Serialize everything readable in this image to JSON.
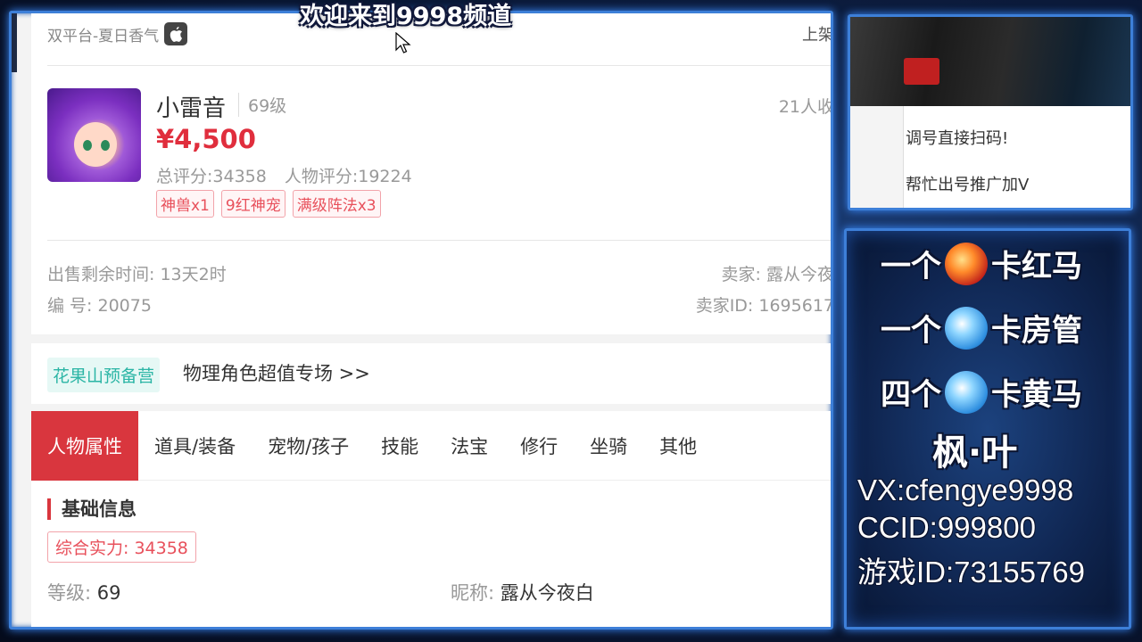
{
  "overlay": {
    "title": "欢迎来到9998频道"
  },
  "listing": {
    "platform": "双平台-夏日香气",
    "listed_label": "上架",
    "character_name": "小雷音",
    "level_badge": "69级",
    "favorites": "21人收",
    "price": "¥4,500",
    "total_score": "总评分:34358",
    "character_score": "人物评分:19224",
    "tags": [
      "神兽x1",
      "9红神宠",
      "满级阵法x3"
    ],
    "sale_time": "出售剩余时间: 13天2时",
    "serial": "编 号: 20075",
    "seller": "卖家: 露从今夜",
    "seller_id": "卖家ID: 1695617"
  },
  "promo": {
    "badge": "花果山预备营",
    "text": "物理角色超值专场 >>"
  },
  "tabs": [
    {
      "label": "人物属性",
      "active": true
    },
    {
      "label": "道具/装备",
      "active": false
    },
    {
      "label": "宠物/孩子",
      "active": false
    },
    {
      "label": "技能",
      "active": false
    },
    {
      "label": "法宝",
      "active": false
    },
    {
      "label": "修行",
      "active": false
    },
    {
      "label": "坐骑",
      "active": false
    },
    {
      "label": "其他",
      "active": false
    }
  ],
  "basic_info": {
    "title": "基础信息",
    "strength": "综合实力: 34358",
    "level_key": "等级:",
    "level_value": "69",
    "nickname_key": "昵称:",
    "nickname_value": "露从今夜白"
  },
  "cam_chat": {
    "line1": "调号直接扫码!",
    "line2": "帮忙出号推广加V"
  },
  "streamer_panel": {
    "promo_lines": [
      {
        "count": "一个",
        "prize": "卡红马",
        "orb": "red"
      },
      {
        "count": "一个",
        "prize": "卡房管",
        "orb": "blue"
      },
      {
        "count": "四个",
        "prize": "卡黄马",
        "orb": "blue"
      }
    ],
    "name": "枫·叶",
    "vx": "VX:cfengye9998",
    "ccid": "CCID:999800",
    "game_id": "游戏ID:73155769"
  },
  "colors": {
    "accent_red": "#d9363e",
    "price_red": "#e02e3d",
    "frame_blue": "#3d7fd8",
    "promo_teal": "#2bb5a5"
  }
}
